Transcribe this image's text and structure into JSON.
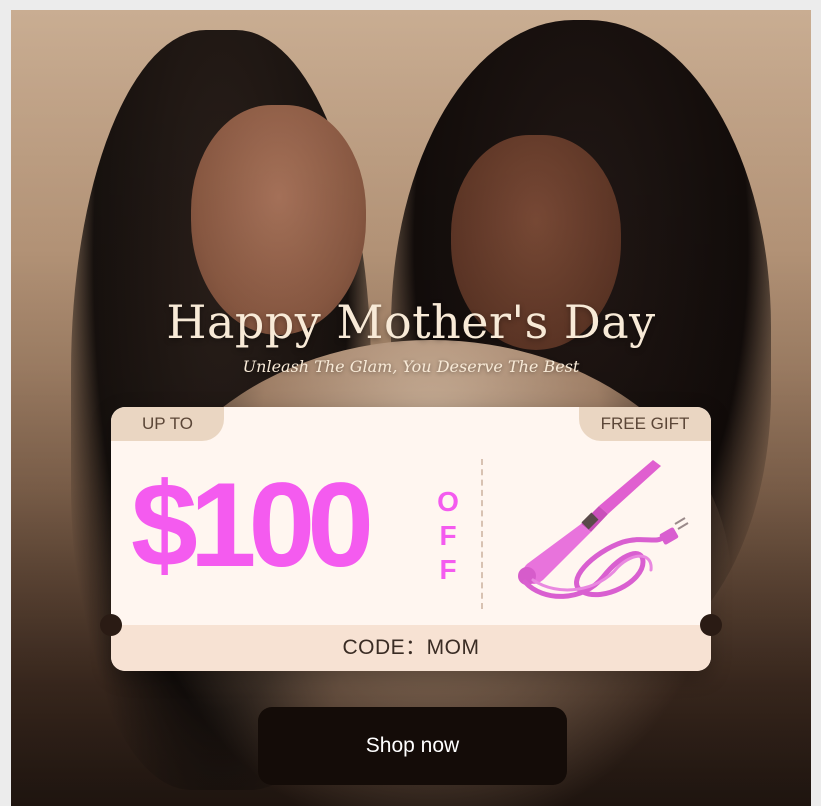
{
  "banner": {
    "title": "Happy Mother's Day",
    "subtitle": "Unleash The Glam, You Deserve The Best"
  },
  "coupon": {
    "up_to_label": "UP TO",
    "free_gift_label": "FREE GIFT",
    "amount": "$100",
    "off_letters": [
      "O",
      "F",
      "F"
    ],
    "code_text": "CODE：MOM",
    "accent_color": "#f45bef",
    "gift_icon": "curling-iron-icon"
  },
  "cta": {
    "shop_label": "Shop now"
  }
}
